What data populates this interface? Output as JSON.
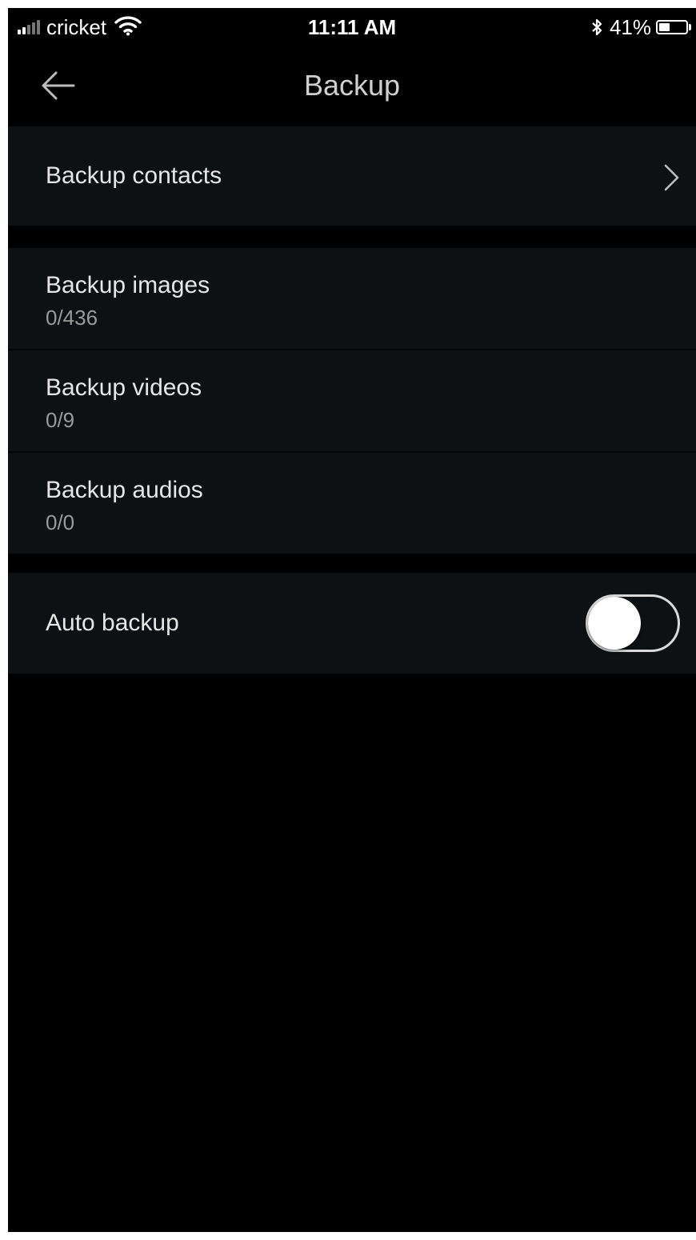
{
  "status_bar": {
    "carrier": "cricket",
    "time": "11:11 AM",
    "battery_percent": "41%",
    "battery_level": 0.41,
    "icons": [
      "signal-icon",
      "wifi-icon",
      "bluetooth-icon",
      "battery-icon"
    ]
  },
  "nav": {
    "title": "Backup",
    "back_icon": "arrow-left-icon"
  },
  "sections": {
    "contacts": {
      "label": "Backup contacts",
      "icon": "chevron-right-icon"
    },
    "media": [
      {
        "label": "Backup images",
        "count": "0/436"
      },
      {
        "label": "Backup videos",
        "count": "0/9"
      },
      {
        "label": "Backup audios",
        "count": "0/0"
      }
    ],
    "auto_backup": {
      "label": "Auto backup",
      "enabled": false
    }
  },
  "colors": {
    "background": "#000000",
    "row_background": "#0e1114",
    "title_text": "#cfcfcf",
    "primary_text": "#e6e6e6",
    "secondary_text": "#9a9a9a"
  }
}
